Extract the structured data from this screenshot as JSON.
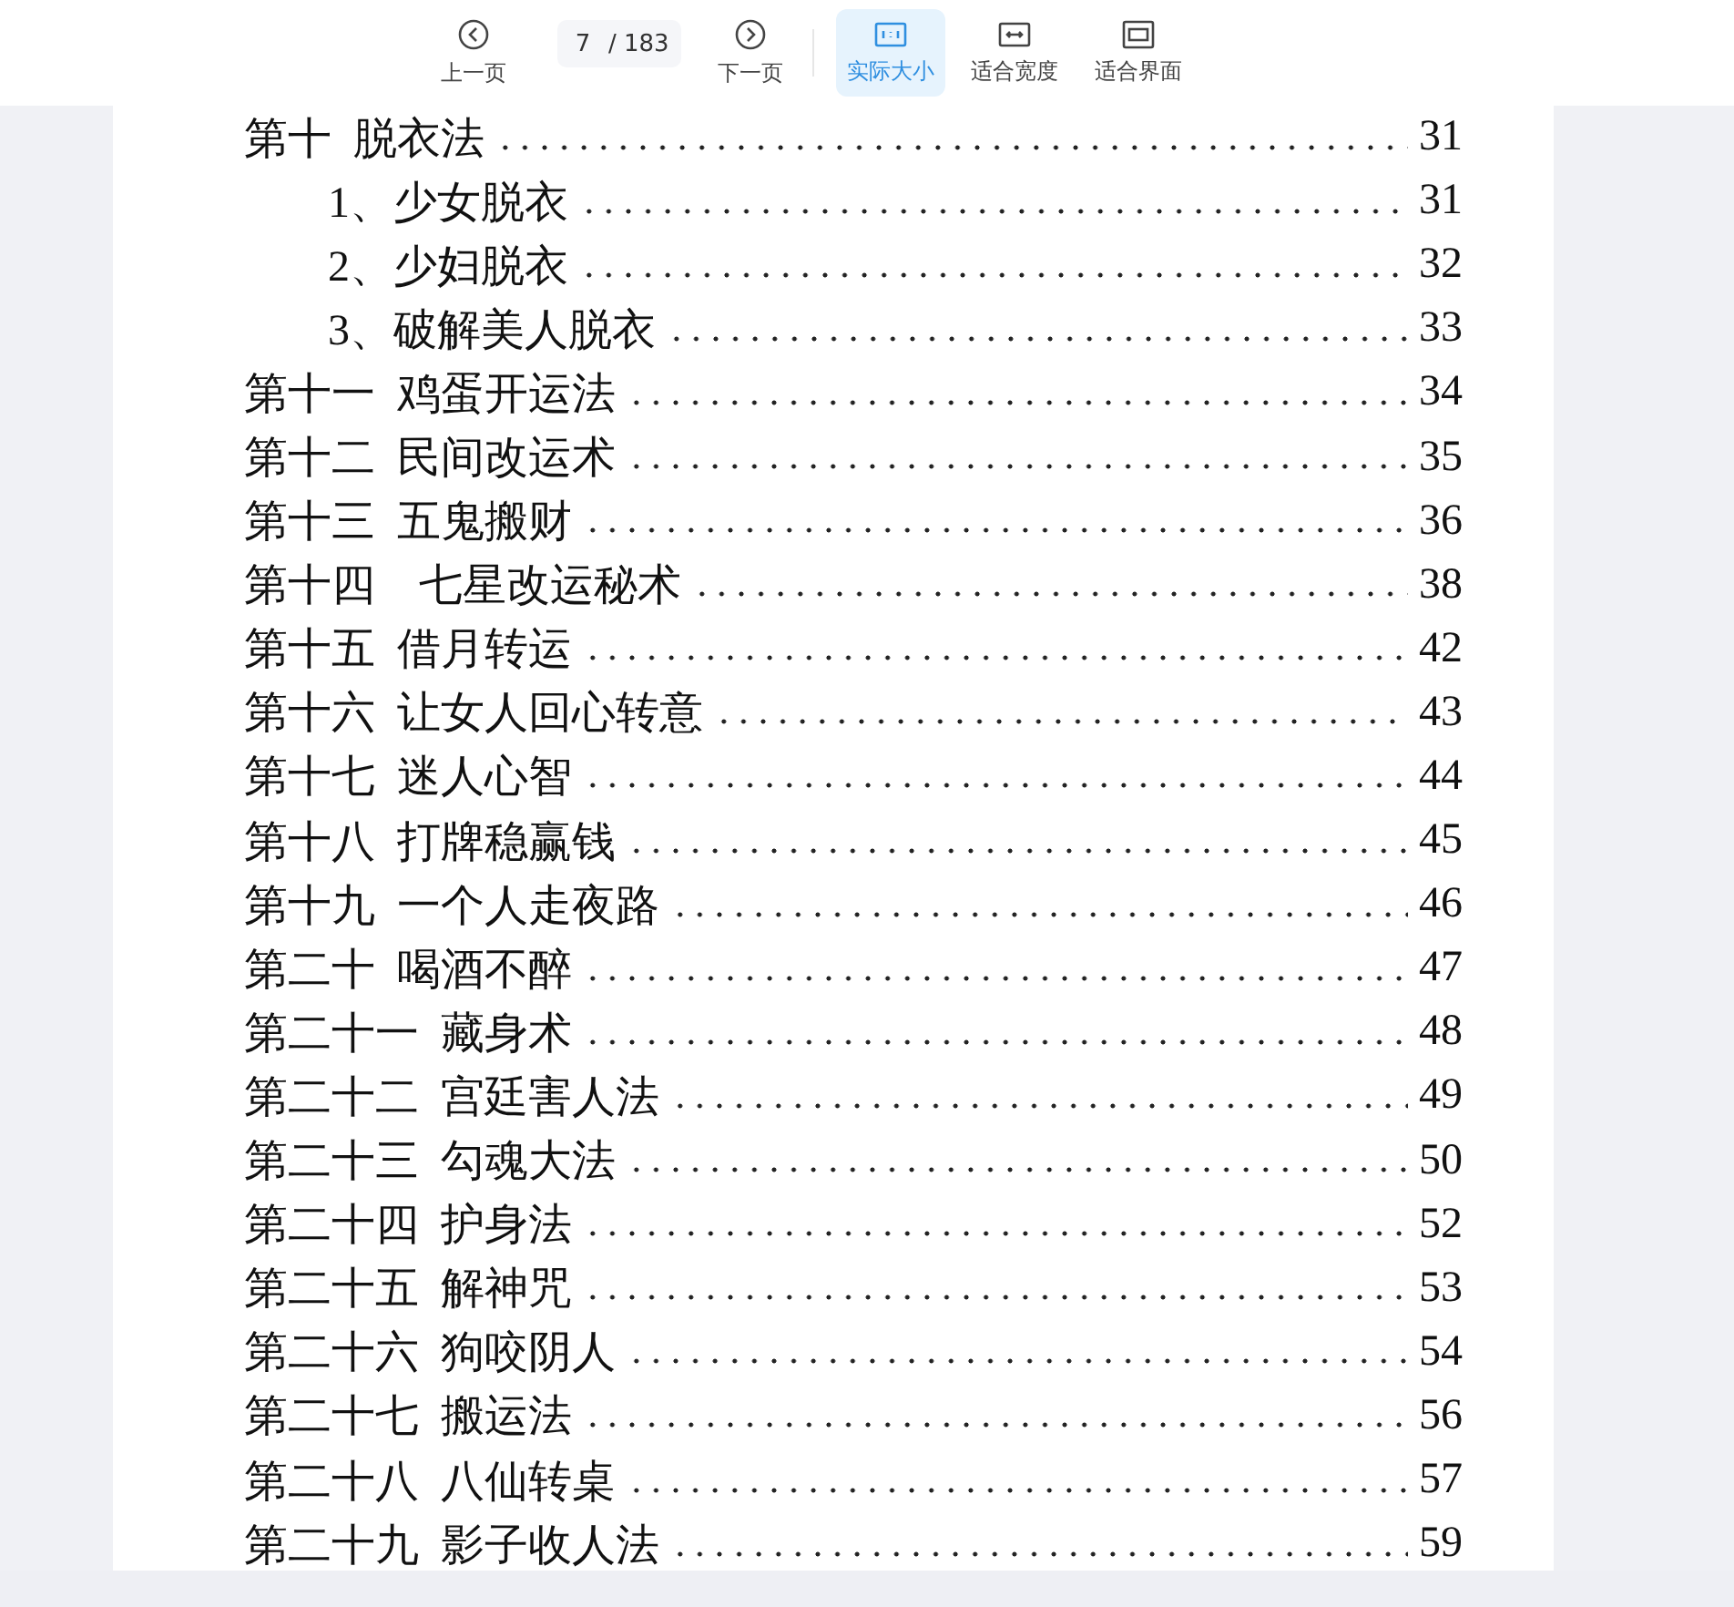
{
  "toolbar": {
    "prev_button": {
      "label": "上一页"
    },
    "page_field": {
      "value": "7",
      "total": "/ 183"
    },
    "next_button": {
      "label": "下一页"
    },
    "zoom_modes": [
      {
        "kind": "actual",
        "label": "实际大小",
        "selected": true
      },
      {
        "kind": "width",
        "label": "适合宽度",
        "selected": false
      },
      {
        "kind": "fit",
        "label": "适合界面",
        "selected": false
      }
    ]
  },
  "toc": [
    {
      "title": "第十  脱衣法",
      "page": "31",
      "children": [
        {
          "title": "1、少女脱衣",
          "page": "31"
        },
        {
          "title": "2、少妇脱衣",
          "page": "32"
        },
        {
          "title": "3、破解美人脱衣",
          "page": "33"
        }
      ]
    },
    {
      "title": "第十一  鸡蛋开运法",
      "page": "34"
    },
    {
      "title": "第十二  民间改运术",
      "page": "35"
    },
    {
      "title": "第十三  五鬼搬财",
      "page": "36"
    },
    {
      "title": "第十四    七星改运秘术",
      "page": "38"
    },
    {
      "title": "第十五  借月转运",
      "page": "42"
    },
    {
      "title": "第十六  让女人回心转意",
      "page": "43"
    },
    {
      "title": "第十七  迷人心智",
      "page": "44"
    },
    {
      "title": "第十八  打牌稳赢钱",
      "page": "45"
    },
    {
      "title": "第十九  一个人走夜路",
      "page": "46"
    },
    {
      "title": "第二十  喝酒不醉",
      "page": "47"
    },
    {
      "title": "第二十一  藏身术",
      "page": "48"
    },
    {
      "title": "第二十二  宫廷害人法",
      "page": "49"
    },
    {
      "title": "第二十三  勾魂大法",
      "page": "50"
    },
    {
      "title": "第二十四  护身法",
      "page": "52"
    },
    {
      "title": "第二十五  解神咒",
      "page": "53"
    },
    {
      "title": "第二十六  狗咬阴人",
      "page": "54"
    },
    {
      "title": "第二十七  搬运法",
      "page": "56"
    },
    {
      "title": "第二十八  八仙转桌",
      "page": "57"
    },
    {
      "title": "第二十九  影子收人法",
      "page": "59"
    }
  ]
}
